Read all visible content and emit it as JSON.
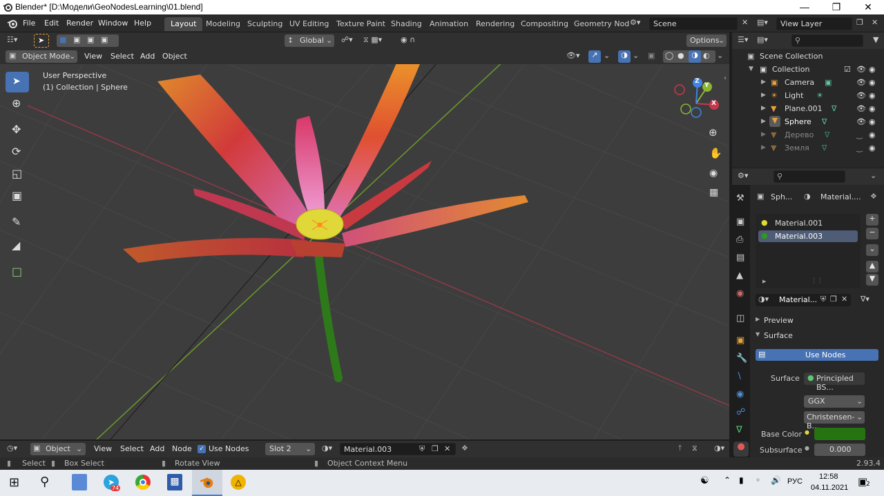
{
  "window": {
    "title": "Blender* [D:\\Модели\\GeoNodesLearning\\01.blend]"
  },
  "menus": [
    "File",
    "Edit",
    "Render",
    "Window",
    "Help"
  ],
  "workspaces": [
    "Layout",
    "Modeling",
    "Sculpting",
    "UV Editing",
    "Texture Paint",
    "Shading",
    "Animation",
    "Rendering",
    "Compositing",
    "Geometry Nod"
  ],
  "scene": {
    "name": "Scene",
    "view_layer": "View Layer"
  },
  "viewport": {
    "mode": "Object Mode",
    "menus": [
      "View",
      "Select",
      "Add",
      "Object"
    ],
    "orientation": "Global",
    "options_label": "Options",
    "overlay_line1": "User Perspective",
    "overlay_line2": "(1) Collection | Sphere",
    "gizmo_axes": [
      "X",
      "Y",
      "Z"
    ]
  },
  "outliner": {
    "scene_collection": "Scene Collection",
    "collection": "Collection",
    "items": [
      {
        "name": "Camera",
        "dim": false
      },
      {
        "name": "Light",
        "dim": false
      },
      {
        "name": "Plane.001",
        "dim": false
      },
      {
        "name": "Sphere",
        "dim": false
      },
      {
        "name": "Дерево",
        "dim": true
      },
      {
        "name": "Земля",
        "dim": true
      }
    ]
  },
  "properties": {
    "object_short": "Sph...",
    "material_short": "Material....",
    "slots": [
      "Material.001",
      "Material.003"
    ],
    "material_field": "Material...",
    "preview_label": "Preview",
    "surface_label": "Surface",
    "use_nodes_button": "Use Nodes",
    "surface_field_label": "Surface",
    "surface_value": "Principled BS...",
    "distribution": "GGX",
    "subsurface_method": "Christensen-B...",
    "base_color_label": "Base Color",
    "base_color": "#267312",
    "subsurface_label": "Subsurface",
    "subsurface_value": "0.000"
  },
  "node_editor": {
    "object_type": "Object",
    "menus": [
      "View",
      "Select",
      "Add",
      "Node"
    ],
    "use_nodes_label": "Use Nodes",
    "slot": "Slot 2",
    "material": "Material.003"
  },
  "statusbar": {
    "select": "Select",
    "box_select": "Box Select",
    "rotate_view": "Rotate View",
    "context_menu": "Object Context Menu",
    "version": "2.93.4"
  },
  "taskbar": {
    "telegram_badge": "74",
    "language": "РУС",
    "time": "12:58",
    "date": "04.11.2021",
    "notifications": "2"
  },
  "colors": {
    "accent": "#4772b3",
    "active_tool": "#4772b3",
    "x_axis": "#c8384c",
    "y_axis": "#8bb631",
    "z_axis": "#3f84e6"
  }
}
